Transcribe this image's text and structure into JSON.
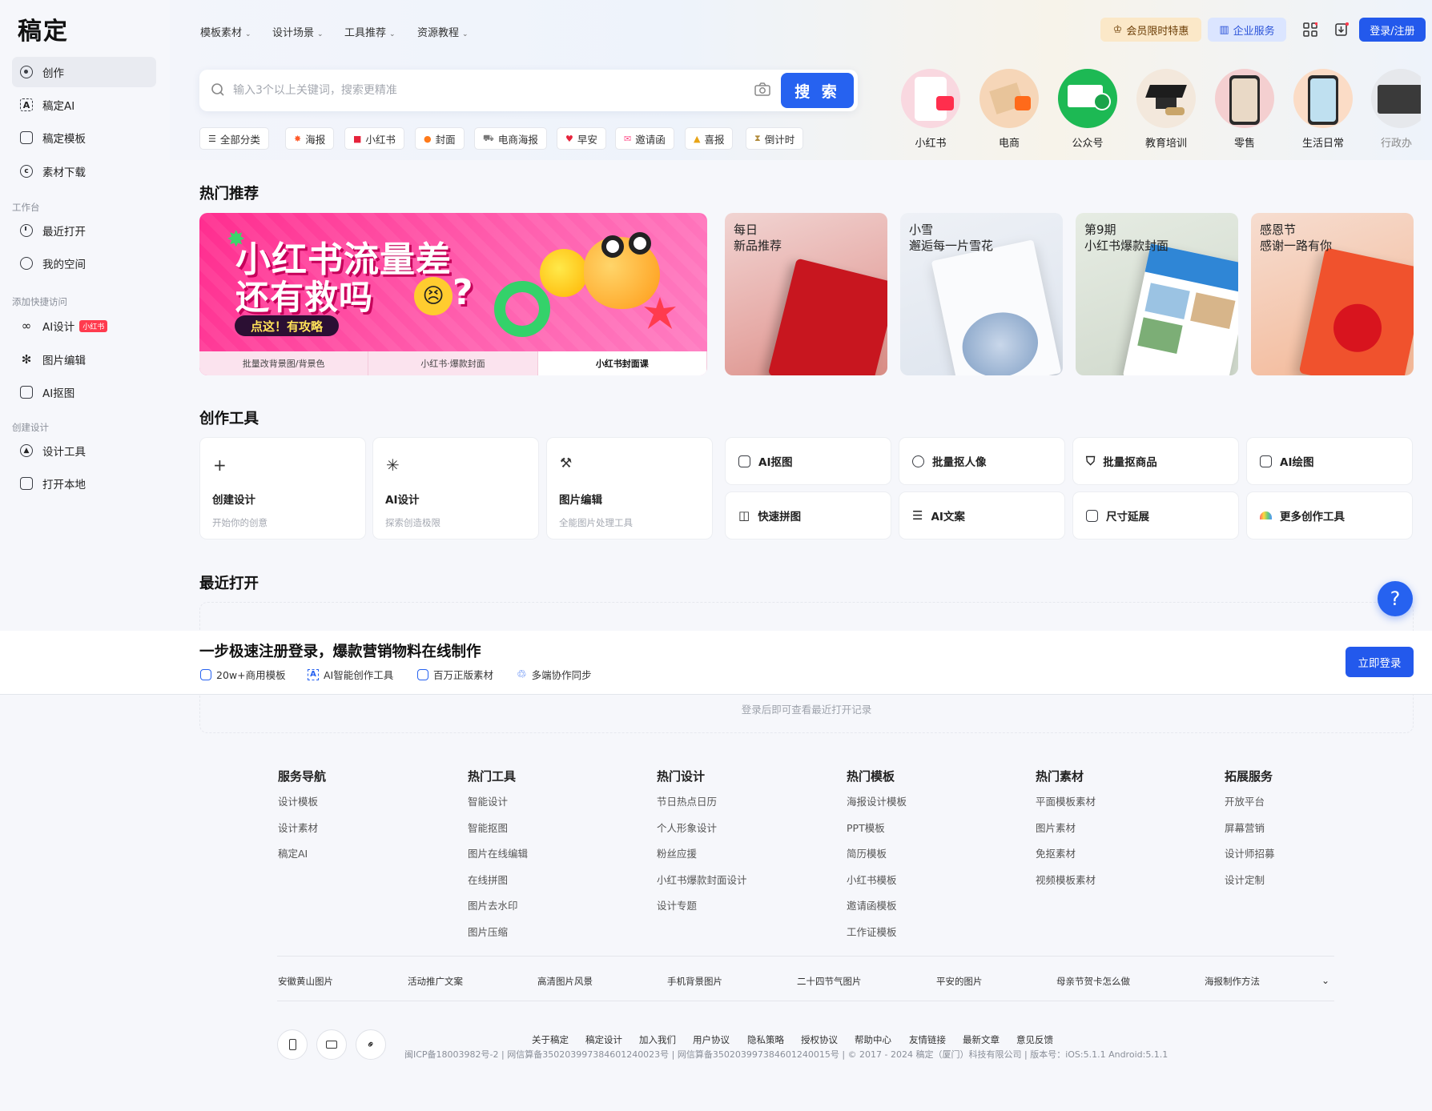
{
  "brand": {
    "logo": "稿定"
  },
  "sidebar": {
    "items": [
      {
        "label": "创作"
      },
      {
        "label": "稿定AI"
      },
      {
        "label": "稿定模板"
      },
      {
        "label": "素材下载"
      }
    ],
    "section_workbench": "工作台",
    "workbench": [
      {
        "label": "最近打开"
      },
      {
        "label": "我的空间"
      }
    ],
    "section_quick": "添加快捷访问",
    "quick": [
      {
        "label": "AI设计",
        "badge": "小红书"
      },
      {
        "label": "图片编辑"
      },
      {
        "label": "AI抠图"
      }
    ],
    "section_create": "创建设计",
    "create": [
      {
        "label": "设计工具"
      },
      {
        "label": "打开本地"
      }
    ]
  },
  "topnav": {
    "menus": [
      "模板素材",
      "设计场景",
      "工具推荐",
      "资源教程"
    ],
    "vip": "会员限时特惠",
    "enterprise": "企业服务",
    "login": "登录/注册"
  },
  "search": {
    "placeholder": "输入3个以上关键词，搜索更精准",
    "button": "搜 索"
  },
  "chips": [
    "全部分类",
    "海报",
    "小红书",
    "封面",
    "电商海报",
    "早安",
    "邀请函",
    "喜报",
    "倒计时"
  ],
  "categories": [
    "小红书",
    "电商",
    "公众号",
    "教育培训",
    "零售",
    "生活日常",
    "行政办"
  ],
  "hot": {
    "title": "热门推荐",
    "banner": {
      "line1": "小红书流量差",
      "line2": "还有救吗",
      "cta": "点这！有攻略",
      "tabs": [
        "批量改背景图/背景色",
        "小红书·爆款封面",
        "小红书封面课"
      ]
    },
    "cards": [
      {
        "line1": "每日",
        "line2": "新品推荐"
      },
      {
        "line1": "小雪",
        "line2": "邂逅每一片雪花"
      },
      {
        "line1": "第9期",
        "line2": "小红书爆款封面"
      },
      {
        "line1": "感恩节",
        "line2": "感谢一路有你"
      }
    ]
  },
  "tools": {
    "title": "创作工具",
    "big": [
      {
        "name": "创建设计",
        "desc": "开始你的创意"
      },
      {
        "name": "AI设计",
        "desc": "探索创造极限"
      },
      {
        "name": "图片编辑",
        "desc": "全能图片处理工具"
      }
    ],
    "small": [
      "AI抠图",
      "批量抠人像",
      "批量抠商品",
      "AI绘图",
      "快速拼图",
      "AI文案",
      "尺寸延展",
      "更多创作工具"
    ]
  },
  "recent": {
    "title": "最近打开",
    "hint": "登录后即可查看最近打开记录"
  },
  "promo": {
    "title": "一步极速注册登录，爆款营销物料在线制作",
    "features": [
      "20w+商用模板",
      "AI智能创作工具",
      "百万正版素材",
      "多端协作同步"
    ],
    "button": "立即登录"
  },
  "help": "?",
  "footer": {
    "columns": [
      {
        "title": "服务导航",
        "links": [
          "设计模板",
          "设计素材",
          "稿定AI"
        ]
      },
      {
        "title": "热门工具",
        "links": [
          "智能设计",
          "智能抠图",
          "图片在线编辑",
          "在线拼图",
          "图片去水印",
          "图片压缩"
        ]
      },
      {
        "title": "热门设计",
        "links": [
          "节日热点日历",
          "个人形象设计",
          "粉丝应援",
          "小红书爆款封面设计",
          "设计专题"
        ]
      },
      {
        "title": "热门模板",
        "links": [
          "海报设计模板",
          "PPT模板",
          "简历模板",
          "小红书模板",
          "邀请函模板",
          "工作证模板"
        ]
      },
      {
        "title": "热门素材",
        "links": [
          "平面模板素材",
          "图片素材",
          "免抠素材",
          "视频模板素材"
        ]
      },
      {
        "title": "拓展服务",
        "links": [
          "开放平台",
          "屏幕营销",
          "设计师招募",
          "设计定制"
        ]
      }
    ],
    "keywords": [
      "安徽黄山图片",
      "活动推广文案",
      "高清图片风景",
      "手机背景图片",
      "二十四节气图片",
      "平安的图片",
      "母亲节贺卡怎么做",
      "海报制作方法"
    ],
    "links": [
      "关于稿定",
      "稿定设计",
      "加入我们",
      "用户协议",
      "隐私策略",
      "授权协议",
      "帮助中心",
      "友情链接",
      "最新文章",
      "意见反馈"
    ],
    "copyright": "闽ICP备18003982号-2  |  网信算备350203997384601240023号  |  网信算备350203997384601240015号  |  © 2017 - 2024 稿定（厦门）科技有限公司  |  版本号：iOS:5.1.1  Android:5.1.1"
  },
  "colors": {
    "primary": "#2662f0",
    "banner_pink": "#ff2d8f",
    "vip_bg": "#fbe8c8",
    "enterprise_bg": "#dbe5ff"
  }
}
